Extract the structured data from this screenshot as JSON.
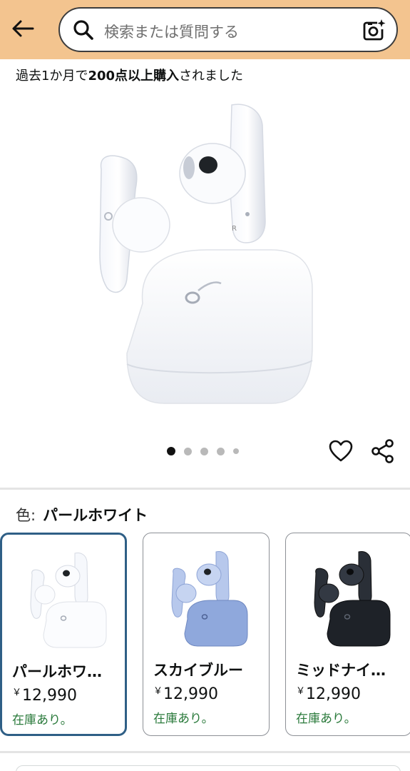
{
  "header": {
    "back_icon": "arrow-left-icon",
    "search": {
      "placeholder": "検索または質問する",
      "search_icon": "magnifier-icon",
      "camera_icon": "camera-sparkle-icon"
    },
    "background_color": "#f3c48f"
  },
  "social_proof": {
    "prefix": "過去1か月で",
    "highlight": "200点以上購入",
    "suffix": "されました"
  },
  "gallery": {
    "image": "white-earbuds-with-charging-case",
    "dot_count": 5,
    "active_dot": 0,
    "wishlist_icon": "heart-outline-icon",
    "share_icon": "share-icon"
  },
  "variant": {
    "label": "色:",
    "selected": "パールホワイト",
    "options": [
      {
        "name": "パールホワイト",
        "display": "パールホワ…",
        "currency": "￥",
        "price": "12,990",
        "stock": "在庫あり。",
        "selected": true,
        "color": "#ffffff"
      },
      {
        "name": "スカイブルー",
        "display": "スカイブルー",
        "currency": "￥",
        "price": "12,990",
        "stock": "在庫あり。",
        "selected": false,
        "color": "#8fa8dc"
      },
      {
        "name": "ミッドナイト",
        "display": "ミッドナイ…",
        "currency": "￥",
        "price": "12,990",
        "stock": "在庫あり。",
        "selected": false,
        "color": "#1e2228"
      }
    ]
  },
  "colors": {
    "accent_border": "#2f5f86",
    "in_stock": "#2a7a3b"
  }
}
